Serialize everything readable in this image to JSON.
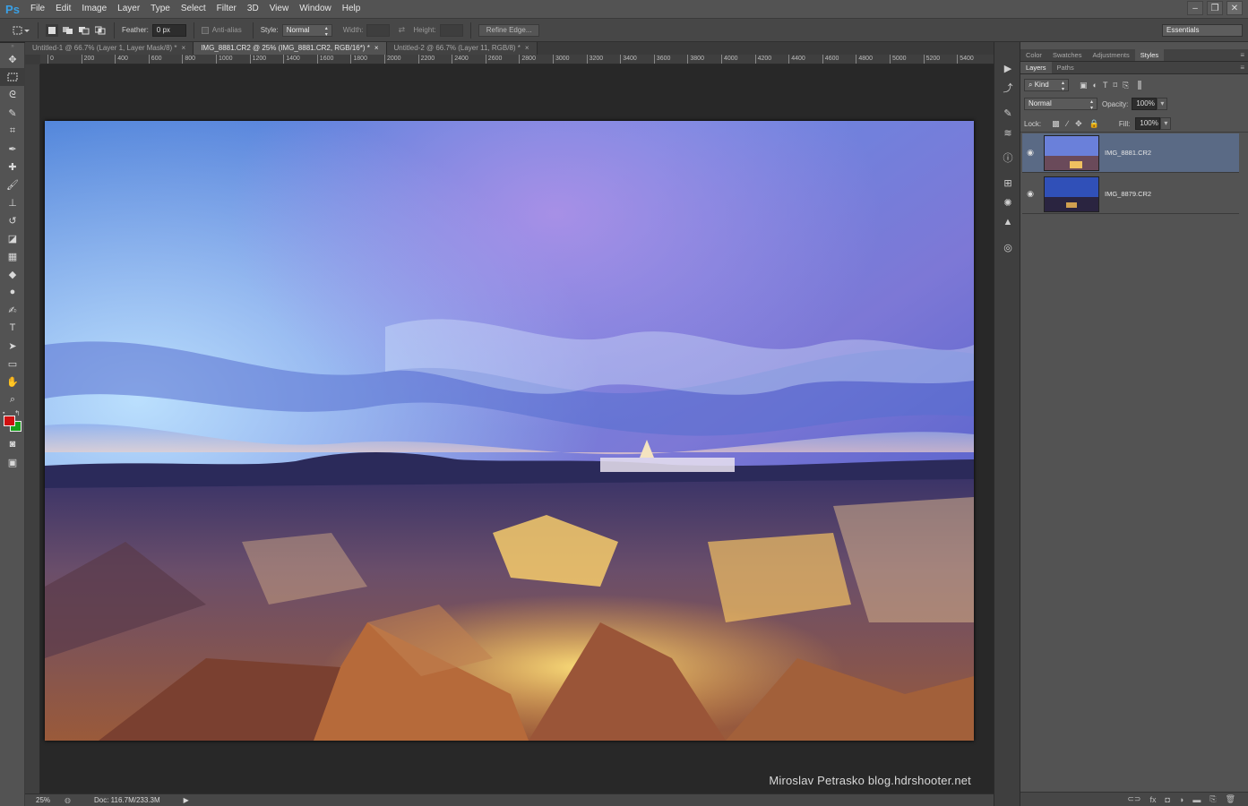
{
  "app": {
    "logo": "Ps"
  },
  "menu": [
    "File",
    "Edit",
    "Image",
    "Layer",
    "Type",
    "Select",
    "Filter",
    "3D",
    "View",
    "Window",
    "Help"
  ],
  "window_controls": {
    "minimize": "–",
    "restore": "❐",
    "close": "✕"
  },
  "options": {
    "feather_label": "Feather:",
    "feather_value": "0 px",
    "antialias_label": "Anti-alias",
    "style_label": "Style:",
    "style_value": "Normal",
    "width_label": "Width:",
    "height_label": "Height:",
    "refine_label": "Refine Edge..."
  },
  "workspace": "Essentials",
  "tabs": [
    {
      "label": "Untitled-1 @ 66.7% (Layer 1, Layer Mask/8) *",
      "close": "×"
    },
    {
      "label": "IMG_8881.CR2 @ 25% (IMG_8881.CR2, RGB/16*) *",
      "close": "×"
    },
    {
      "label": "Untitled-2 @ 66.7% (Layer 11, RGB/8) *",
      "close": "×"
    }
  ],
  "ruler": [
    "0",
    "200",
    "400",
    "600",
    "800",
    "1000",
    "1200",
    "1400",
    "1600",
    "1800",
    "2000",
    "2200",
    "2400",
    "2600",
    "2800",
    "3000",
    "3200",
    "3400",
    "3600",
    "3800",
    "4000",
    "4200",
    "4400",
    "4600",
    "4800",
    "5000",
    "5200",
    "5400"
  ],
  "watermark": "Miroslav  Petrasko  blog.hdrshooter.net",
  "status": {
    "zoom": "25%",
    "doc": "Doc: 116.7M/233.3M"
  },
  "panel_tabs_top": [
    "Color",
    "Swatches",
    "Adjustments",
    "Styles"
  ],
  "panel_tabs_layers": [
    "Layers",
    "Paths"
  ],
  "layers_panel": {
    "kind_label": "Kind",
    "blend_mode": "Normal",
    "opacity_label": "Opacity:",
    "opacity_value": "100%",
    "lock_label": "Lock:",
    "fill_label": "Fill:",
    "fill_value": "100%"
  },
  "layers": [
    {
      "name": "IMG_8881.CR2",
      "selected": true
    },
    {
      "name": "IMG_8879.CR2",
      "selected": false
    }
  ],
  "colors": {
    "foreground": "#d01010",
    "background": "#16a21a",
    "accent": "#3aa0e6"
  }
}
